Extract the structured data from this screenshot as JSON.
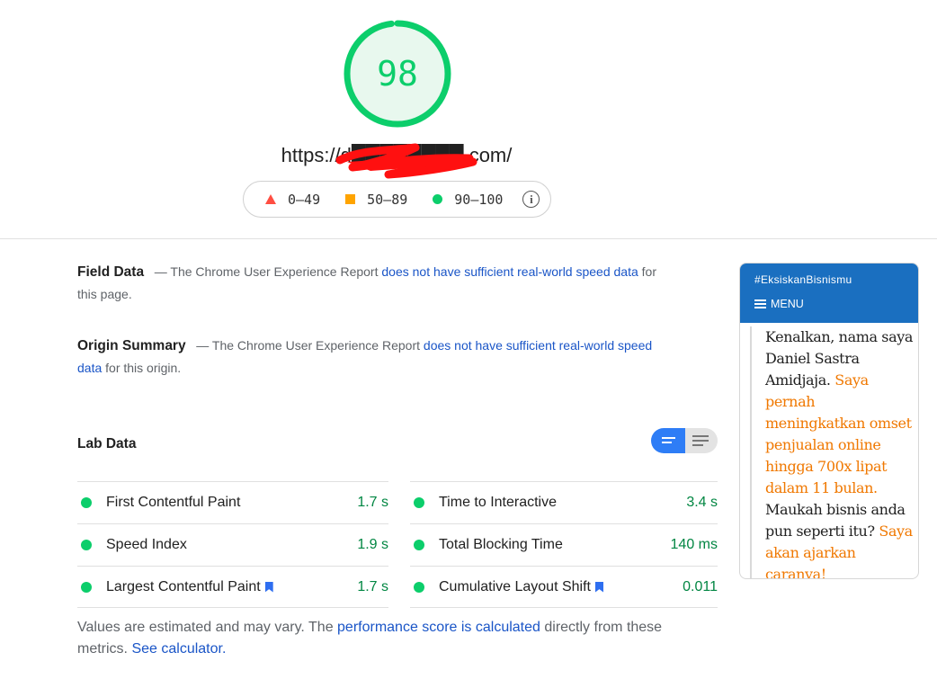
{
  "score": {
    "value": "98",
    "fraction": 0.98,
    "color": "#0cce6b"
  },
  "url": {
    "text": "https://d████████.com/"
  },
  "legend": {
    "fail": "0–49",
    "average": "50–89",
    "pass": "90–100",
    "info_icon": "info-icon"
  },
  "field_data": {
    "title": "Field Data",
    "dash": "—",
    "text_before": "The Chrome User Experience Report",
    "link": "does not have sufficient real-world speed data",
    "text_after": "for this page."
  },
  "origin_summary": {
    "title": "Origin Summary",
    "dash": "—",
    "text_before": "The Chrome User Experience Report",
    "link": "does not have sufficient real-world speed data",
    "text_after": "for this origin."
  },
  "lab_data": {
    "title": "Lab Data",
    "metrics_left": [
      {
        "name": "First Contentful Paint",
        "value": "1.7 s",
        "flag": false
      },
      {
        "name": "Speed Index",
        "value": "1.9 s",
        "flag": false
      },
      {
        "name": "Largest Contentful Paint",
        "value": "1.7 s",
        "flag": true
      }
    ],
    "metrics_right": [
      {
        "name": "Time to Interactive",
        "value": "3.4 s",
        "flag": false
      },
      {
        "name": "Total Blocking Time",
        "value": "140 ms",
        "flag": false
      },
      {
        "name": "Cumulative Layout Shift",
        "value": "0.011",
        "flag": true
      }
    ]
  },
  "footnote": {
    "before": "Values are estimated and may vary. The ",
    "link1": "performance score is calculated",
    "middle": " directly from these metrics. ",
    "link2": "See calculator."
  },
  "thumbnail": {
    "hashtag": "#EksiskanBisnismu",
    "menu_label": "MENU",
    "text_normal_1": "Kenalkan, nama saya Daniel Sastra Amidjaja.",
    "text_highlight_1": "Saya pernah meningkatkan omset penjualan online hingga 700x lipat dalam 11 bulan.",
    "text_normal_2": "Maukah bisnis anda pun seperti itu?",
    "text_highlight_2": "Saya akan ajarkan caranya!"
  },
  "colors": {
    "pass": "#0cce6b",
    "average": "#ffa400",
    "fail": "#ff4e42",
    "link": "#1a55c7",
    "toggle_active": "#2e7df6",
    "thumb_header": "#1a6fc0",
    "thumb_highlight": "#f07800"
  }
}
